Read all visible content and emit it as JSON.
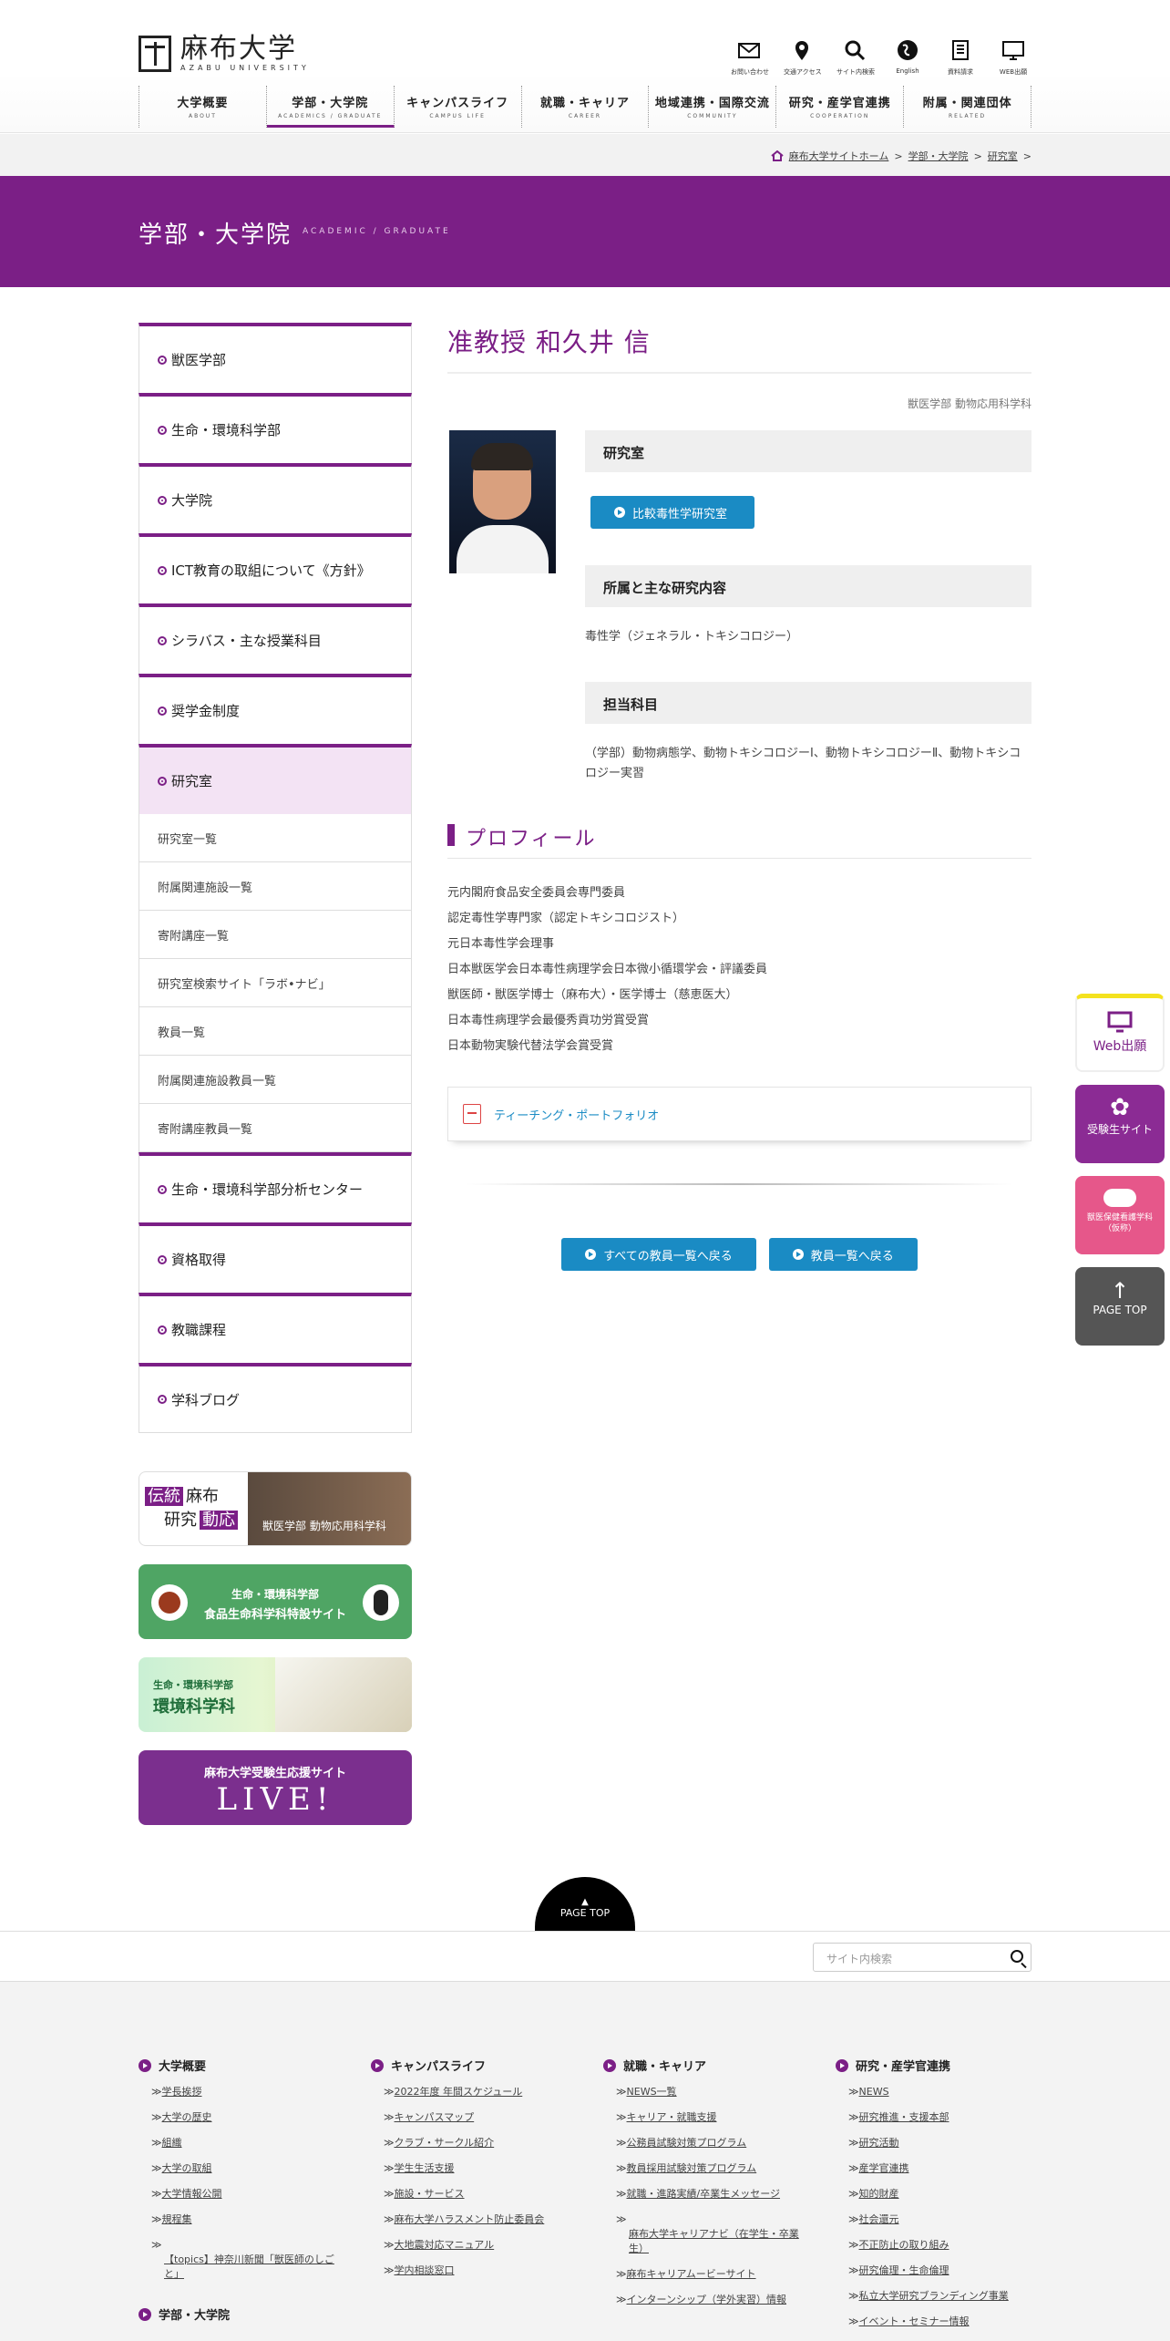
{
  "colors": {
    "brand": "#7b1f86",
    "link": "#1a8bc4"
  },
  "social": [
    {
      "icon": "twitter-icon",
      "color": "#4aa1eb"
    },
    {
      "icon": "facebook-icon",
      "color": "#3b5998"
    },
    {
      "icon": "instagram-icon",
      "color": "#c13584"
    },
    {
      "icon": "line-icon",
      "color": "#06c755"
    },
    {
      "icon": "youtube-icon",
      "color": "#e62117"
    }
  ],
  "header": {
    "logo_jp": "麻布大学",
    "logo_en": "AZABU UNIVERSITY",
    "util": [
      {
        "icon": "mail-icon",
        "label": "お問い合わせ"
      },
      {
        "icon": "map-pin-icon",
        "label": "交通アクセス"
      },
      {
        "icon": "search-icon",
        "label": "サイト内検索"
      },
      {
        "icon": "globe-icon",
        "label": "English"
      },
      {
        "icon": "book-icon",
        "label": "資料請求"
      },
      {
        "icon": "monitor-icon",
        "label": "WEB出願"
      }
    ],
    "nav": [
      {
        "jp": "大学概要",
        "en": "ABOUT"
      },
      {
        "jp": "学部・大学院",
        "en": "ACADEMICS / GRADUATE"
      },
      {
        "jp": "キャンパスライフ",
        "en": "CAMPUS LIFE"
      },
      {
        "jp": "就職・キャリア",
        "en": "CAREER"
      },
      {
        "jp": "地域連携・国際交流",
        "en": "COMMUNITY"
      },
      {
        "jp": "研究・産学官連携",
        "en": "COOPERATION"
      },
      {
        "jp": "附属・関連団体",
        "en": "RELATED"
      }
    ]
  },
  "breadcrumb": [
    "麻布大学サイトホーム",
    "学部・大学院",
    "研究室"
  ],
  "hero": {
    "title": "学部・大学院",
    "en": "ACADEMIC / GRADUATE"
  },
  "sidebar": {
    "items": [
      "獣医学部",
      "生命・環境科学部",
      "大学院",
      "ICT教育の取組について《方針》",
      "シラバス・主な授業科目",
      "奨学金制度",
      "研究室"
    ],
    "sub": [
      "研究室一覧",
      "附属関連施設一覧",
      "寄附講座一覧",
      "研究室検索サイト「ラボ•ナビ」",
      "教員一覧",
      "附属関連施設教員一覧",
      "寄附講座教員一覧"
    ],
    "items2": [
      "生命・環境科学部分析センター",
      "資格取得",
      "教職課程",
      "学科ブログ"
    ]
  },
  "banners": {
    "b1": {
      "t1": "伝統",
      "t2": "麻布",
      "t3": "研究",
      "t4": "動応",
      "caption": "獣医学部 動物応用科学科"
    },
    "b2": {
      "line1": "生命・環境科学部",
      "line2": "食品生命科学科特設サイト"
    },
    "b3": {
      "line1": "生命・環境科学部",
      "line2": "環境科学科"
    },
    "b4": {
      "line1": "麻布大学受験生応援サイト",
      "line2": "LIVE!"
    }
  },
  "main": {
    "title": "准教授 和久井 信",
    "dept": "獣医学部 動物応用科学科",
    "lab_head": "研究室",
    "lab_btn": "比較毒性学研究室",
    "research_head": "所属と主な研究内容",
    "research": "毒性学（ジェネラル・トキシコロジー）",
    "subjects_head": "担当科目",
    "subjects": "（学部）動物病態学、動物トキシコロジーⅠ、動物トキシコロジーⅡ、動物トキシコロジー実習",
    "profile_title": "プロフィール",
    "profile": [
      "元内閣府食品安全委員会専門委員",
      "認定毒性学専門家（認定トキシコロジスト）",
      "元日本毒性学会理事",
      "日本獣医学会日本毒性病理学会日本微小循環学会・評議委員",
      "獣医師・獣医学博士（麻布大）・医学博士（慈恵医大）",
      "日本毒性病理学会最優秀貢功労賞受賞",
      "日本動物実験代替法学会賞受賞"
    ],
    "portfolio": "ティーチング・ポートフォリオ",
    "back_all": "すべての教員一覧へ戻る",
    "back": "教員一覧へ戻る"
  },
  "floats": {
    "web": "Web出願",
    "exam": "受験生サイト",
    "vet": "獣医保健看護学科（仮称）",
    "top": "PAGE TOP"
  },
  "pagetop": "PAGE TOP",
  "search": {
    "placeholder": "サイト内検索"
  },
  "footer": [
    {
      "head": "大学概要",
      "links": [
        "学長挨拶",
        "大学の歴史",
        "組織",
        "大学の取組",
        "大学情報公開",
        "規程集",
        "【topics】神奈川新聞「獣医師のしごと」"
      ]
    },
    {
      "head": "キャンパスライフ",
      "links": [
        "2022年度 年間スケジュール",
        "キャンパスマップ",
        "クラブ・サークル紹介",
        "学生生活支援",
        "施設・サービス",
        "麻布大学ハラスメント防止委員会",
        "大地震対応マニュアル",
        "学内相談窓口"
      ]
    },
    {
      "head": "就職・キャリア",
      "links": [
        "NEWS一覧",
        "キャリア・就職支援",
        "公務員試験対策プログラム",
        "教員採用試験対策プログラム",
        "就職・進路実績/卒業生メッセージ",
        "麻布大学キャリアナビ（在学生・卒業生）",
        "麻布キャリアムービーサイト",
        "インターンシップ（学外実習）情報"
      ]
    },
    {
      "head": "研究・産学官連携",
      "links": [
        "NEWS",
        "研究推進・支援本部",
        "研究活動",
        "産学官連携",
        "知的財産",
        "社会還元",
        "不正防止の取り組み",
        "研究倫理・生命倫理",
        "私立大学研究ブランディング事業",
        "イベント・セミナー情報"
      ]
    }
  ],
  "footer2_head": "学部・大学院"
}
